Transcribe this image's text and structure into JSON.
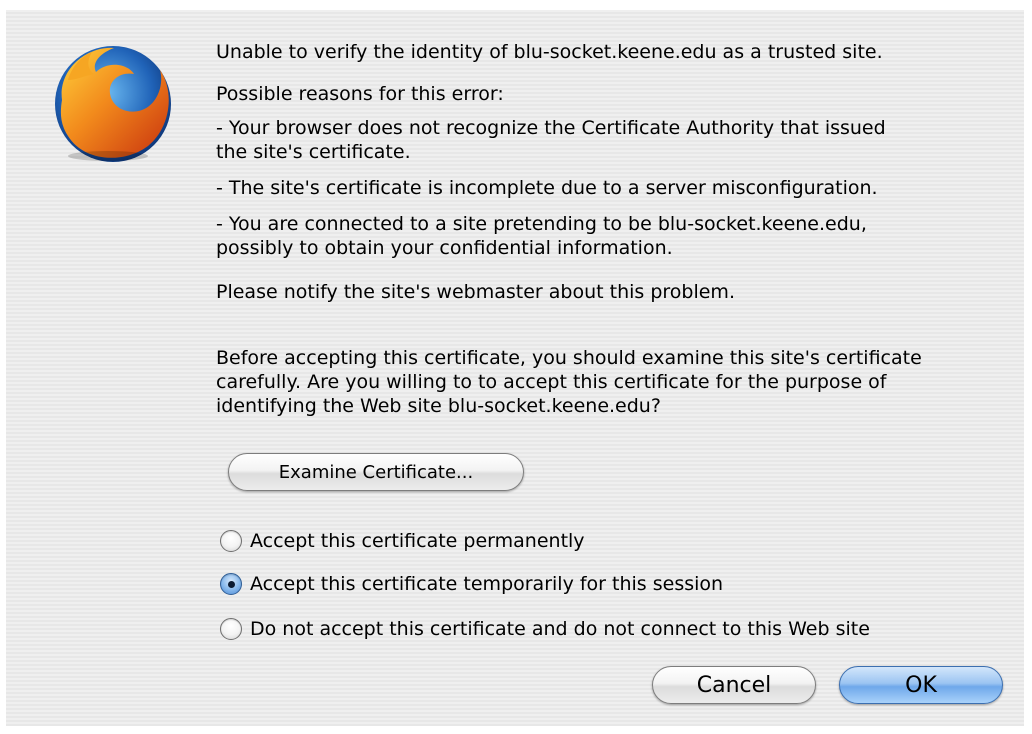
{
  "dialog": {
    "title_message": "Unable to verify the identity of blu-socket.keene.edu as a trusted site.",
    "reasons_heading": "Possible reasons for this error:",
    "reason_1_line1": "- Your browser does not recognize the Certificate Authority that issued",
    "reason_1_line2": "the site's certificate.",
    "reason_2": "- The site's certificate is incomplete due to a server misconfiguration.",
    "reason_3_line1": "- You are connected to a site pretending to be blu-socket.keene.edu,",
    "reason_3_line2": "possibly to obtain your confidential information.",
    "notify": "Please notify the site's webmaster about this problem.",
    "prompt_line1": "Before accepting this certificate, you should examine this site's certificate",
    "prompt_line2": "carefully. Are you willing to to accept this certificate for the purpose of",
    "prompt_line3": "identifying the Web site blu-socket.keene.edu?",
    "examine_button": "Examine Certificate...",
    "options": [
      {
        "label": "Accept this certificate permanently",
        "selected": false
      },
      {
        "label": "Accept this certificate temporarily for this session",
        "selected": true
      },
      {
        "label": "Do not accept this certificate and do not connect to this Web site",
        "selected": false
      }
    ],
    "cancel_button": "Cancel",
    "ok_button": "OK"
  },
  "icon": "firefox-logo-icon"
}
